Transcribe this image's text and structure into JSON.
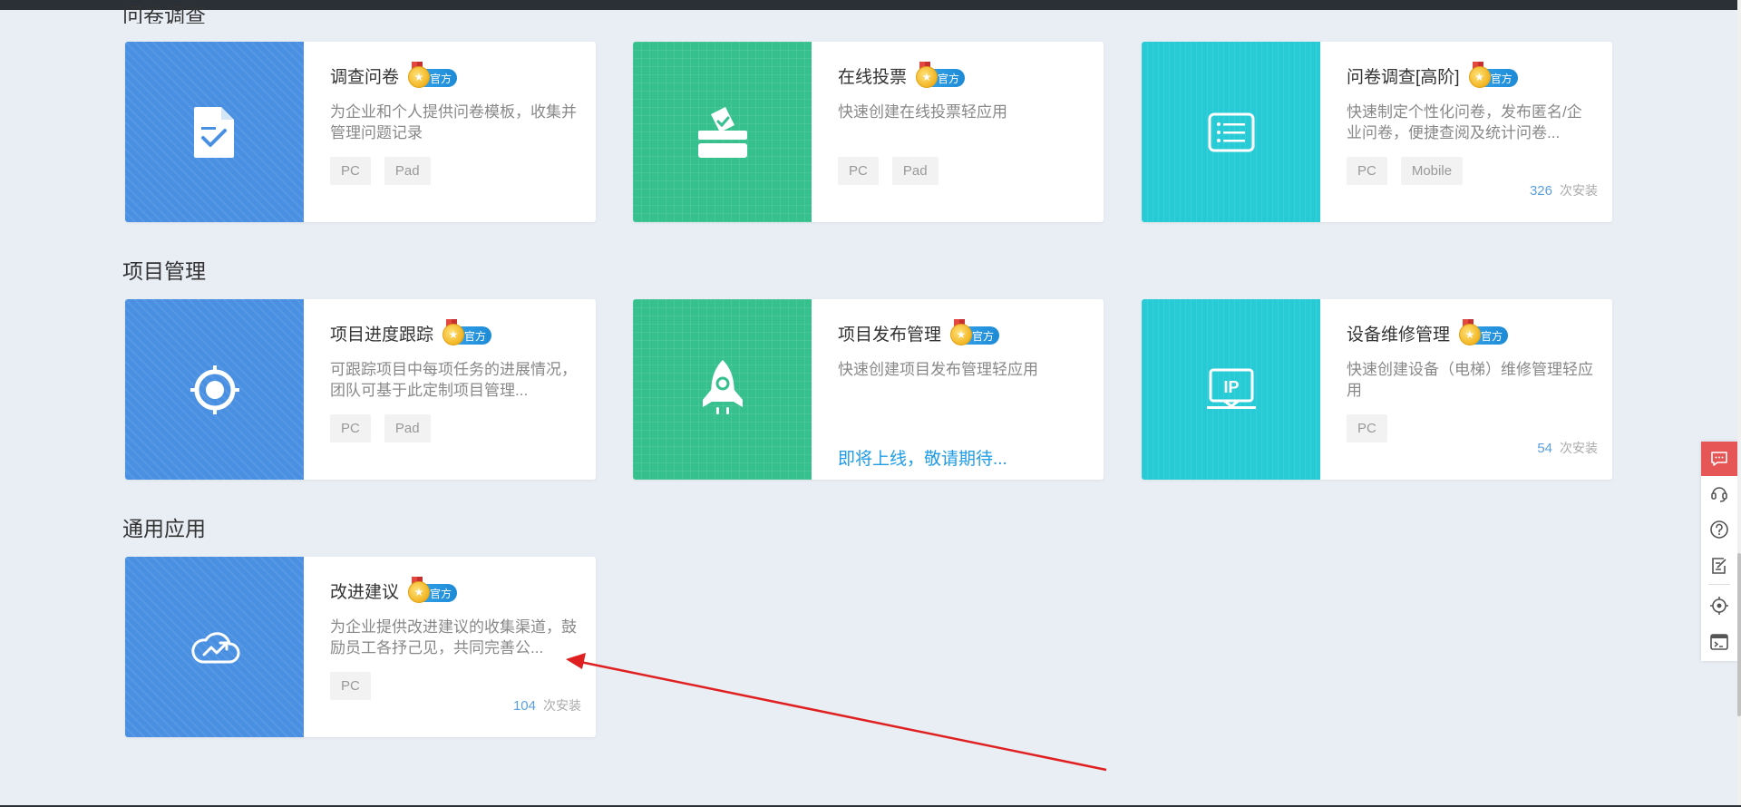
{
  "sections": [
    {
      "title": "问卷调查",
      "cards": [
        {
          "title": "调查问卷",
          "badge": "官方",
          "desc": "为企业和个人提供问卷模板，收集并管理问题记录",
          "tags": [
            "PC",
            "Pad"
          ],
          "icon": "survey-document-icon",
          "color": "blue"
        },
        {
          "title": "在线投票",
          "badge": "官方",
          "desc": "快速创建在线投票轻应用",
          "tags": [
            "PC",
            "Pad"
          ],
          "icon": "ballot-box-icon",
          "color": "green"
        },
        {
          "title": "问卷调查[高阶]",
          "badge": "官方",
          "desc": "快速制定个性化问卷，发布匿名/企业问卷，便捷查阅及统计问卷...",
          "tags": [
            "PC",
            "Mobile"
          ],
          "installs": "326",
          "icon": "list-icon",
          "color": "cyan"
        }
      ]
    },
    {
      "title": "项目管理",
      "cards": [
        {
          "title": "项目进度跟踪",
          "badge": "官方",
          "desc": "可跟踪项目中每项任务的进展情况，团队可基于此定制项目管理...",
          "tags": [
            "PC",
            "Pad"
          ],
          "icon": "target-icon",
          "color": "blue"
        },
        {
          "title": "项目发布管理",
          "badge": "官方",
          "desc": "快速创建项目发布管理轻应用",
          "coming": "即将上线，敬请期待...",
          "icon": "rocket-icon",
          "color": "green"
        },
        {
          "title": "设备维修管理",
          "badge": "官方",
          "desc": "快速创建设备（电梯）维修管理轻应用",
          "tags": [
            "PC"
          ],
          "installs": "54",
          "icon": "ip-monitor-icon",
          "color": "cyan"
        }
      ]
    },
    {
      "title": "通用应用",
      "cards": [
        {
          "title": "改进建议",
          "badge": "官方",
          "desc": "为企业提供改进建议的收集渠道，鼓励员工各抒己见，共同完善公...",
          "tags": [
            "PC"
          ],
          "installs": "104",
          "icon": "cloud-trend-icon",
          "color": "blue"
        }
      ]
    }
  ],
  "installs_suffix": "次安装",
  "sidebar": {
    "icons": [
      "message-icon",
      "headset-icon",
      "help-icon",
      "edit-note-icon",
      "locate-icon",
      "terminal-icon"
    ]
  },
  "colors": {
    "blue": "#4a90e2",
    "green": "#36c08e",
    "cyan": "#27cbd6",
    "accent_red": "#e65656",
    "link": "#1f9ce8"
  },
  "annotation": {
    "type": "red-arrow",
    "target": "改进建议 card description"
  }
}
